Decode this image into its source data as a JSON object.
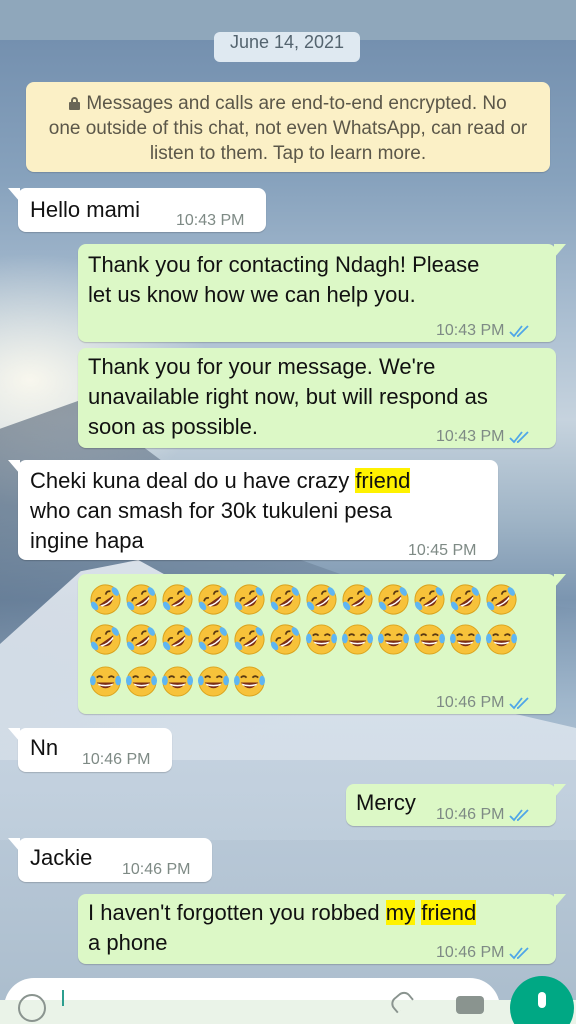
{
  "chat": {
    "date_chip": "June 14, 2021",
    "encryption_notice": [
      "Messages and calls are end-to-end encrypted. No",
      "one outside of this chat, not even WhatsApp, can read or",
      "listen to them. Tap to learn more."
    ],
    "messages": [
      {
        "direction": "incoming",
        "lines": [
          "Hello mami"
        ],
        "time": "10:43 PM"
      },
      {
        "direction": "outgoing",
        "lines": [
          "Thank you for contacting Ndagh! Please",
          "let us know how we can help you."
        ],
        "time": "10:43 PM",
        "status": "read"
      },
      {
        "direction": "outgoing",
        "lines": [
          "Thank you for your message. We're",
          "unavailable right now, but will respond as",
          "soon as possible."
        ],
        "time": "10:43 PM",
        "status": "read"
      },
      {
        "direction": "incoming",
        "lines": [
          "Cheki kuna deal do u have crazy ",
          "friend",
          "who can smash for 30k tukuleni pesa",
          "ingine hapa"
        ],
        "time": "10:45 PM"
      },
      {
        "direction": "outgoing",
        "emoji": {
          "rolling_on_floor_laughing": 18,
          "face_with_tears_of_joy": 11
        },
        "time": "10:46 PM",
        "status": "read"
      },
      {
        "direction": "incoming",
        "lines": [
          "Nn"
        ],
        "time": "10:46 PM"
      },
      {
        "direction": "outgoing",
        "lines": [
          "Mercy"
        ],
        "time": "10:46 PM",
        "status": "read"
      },
      {
        "direction": "incoming",
        "lines": [
          "Jackie"
        ],
        "time": "10:46 PM"
      },
      {
        "direction": "outgoing",
        "lines": [
          "I haven't  forgotten  you robbed ",
          "my",
          " ",
          "friend",
          "a phone"
        ],
        "time": "10:46 PM",
        "status": "read"
      }
    ]
  },
  "colors": {
    "incoming_bubble": "#ffffff",
    "outgoing_bubble": "#dcf8c6",
    "read_ticks": "#4fa6e8",
    "highlight": "#fff200",
    "encryption_bg": "#fbf0c6",
    "send_button": "#00a884"
  },
  "icons": {
    "lock": "lock-icon",
    "read_status": "double-check-icon",
    "emoji_a": "rolling-on-floor-laughing-emoji",
    "emoji_b": "face-with-tears-of-joy-emoji",
    "composer": [
      "emoji-icon",
      "attach-icon",
      "camera-icon",
      "mic-icon"
    ]
  }
}
